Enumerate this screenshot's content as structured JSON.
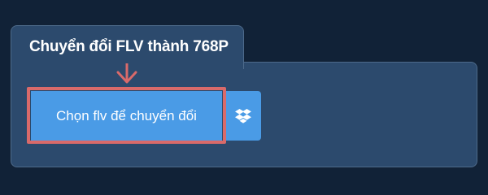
{
  "converter": {
    "tab_title": "Chuyển đổi FLV thành 768P",
    "choose_button_label": "Chọn flv để chuyển đổi",
    "dropbox_icon": "dropbox-icon",
    "arrow_icon": "arrow-down-icon"
  },
  "colors": {
    "page_background": "#112237",
    "panel_background": "#2c4a6d",
    "panel_border": "#4d6a8a",
    "button_background": "#4a9be6",
    "highlight_border": "#d96a6a",
    "text": "#ffffff"
  }
}
